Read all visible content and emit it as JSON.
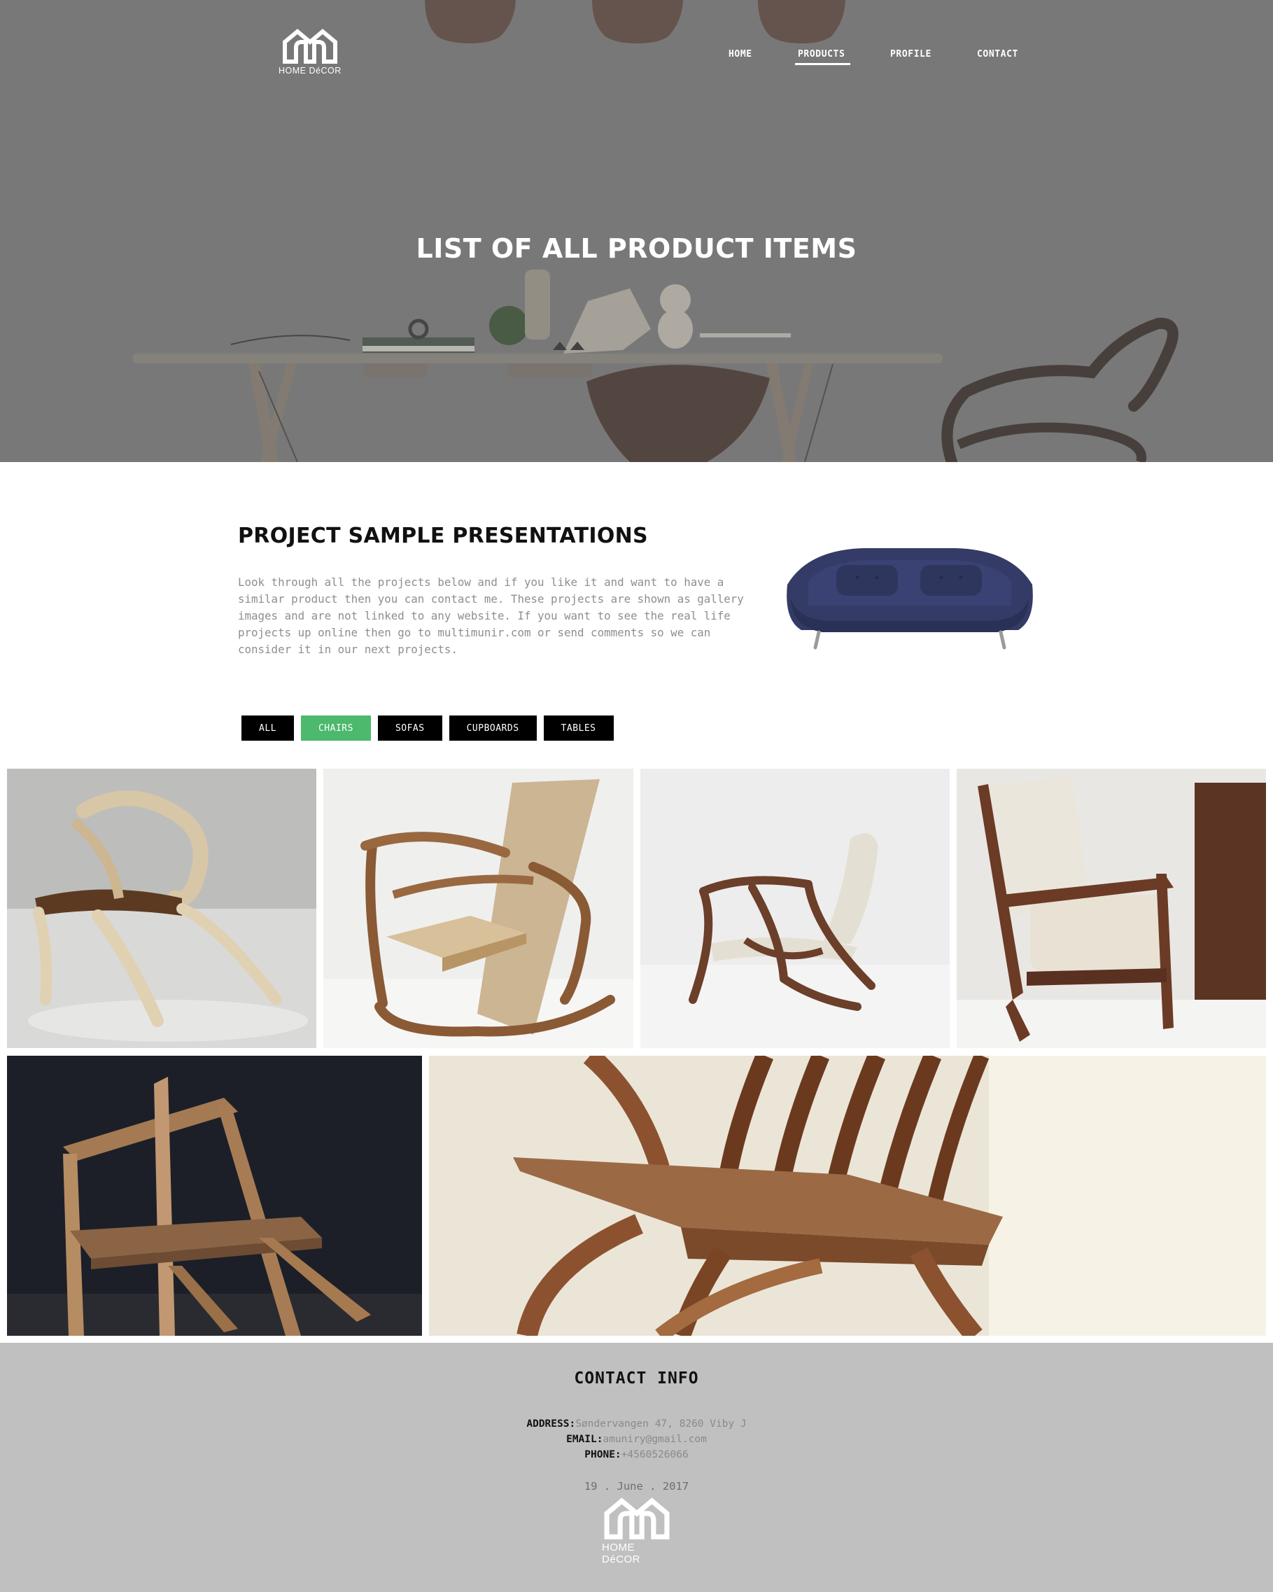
{
  "brand": {
    "logo_text": "HOME DéCOR"
  },
  "nav": {
    "items": [
      {
        "label": "HOME"
      },
      {
        "label": "PRODUCTS"
      },
      {
        "label": "PROFILE"
      },
      {
        "label": "CONTACT"
      }
    ],
    "active": "PRODUCTS"
  },
  "hero": {
    "title": "LIST OF ALL PRODUCT ITEMS"
  },
  "intro": {
    "title": "PROJECT SAMPLE PRESENTATIONS",
    "text": "Look through all the projects below and if you like it and want to have a similar product then you can contact me. These projects are shown as gallery images and are not linked to any website. If you want to see the real life projects up online then go to multimunir.com or send comments so we can consider it in our next projects."
  },
  "filters": {
    "items": [
      {
        "label": "ALL"
      },
      {
        "label": "CHAIRS"
      },
      {
        "label": "SOFAS"
      },
      {
        "label": "CUPBOARDS"
      },
      {
        "label": "TABLES"
      }
    ],
    "active": "CHAIRS"
  },
  "gallery": {
    "images": [
      {
        "icon": "sculptural-wood-chair-image"
      },
      {
        "icon": "rocking-chair-image"
      },
      {
        "icon": "lounge-chair-image"
      },
      {
        "icon": "upholstered-armchair-image"
      },
      {
        "icon": "angular-wood-chair-image"
      },
      {
        "icon": "curved-wood-chair-closeup-image"
      }
    ]
  },
  "footer": {
    "title": "CONTACT INFO",
    "address_label": "ADDRESS:",
    "address": "Søndervangen 47, 8260 Viby J",
    "email_label": "EMAIL:",
    "email": "amuniry@gmail.com",
    "phone_label": "PHONE:",
    "phone": "+4560526066",
    "date": "19 . June . 2017",
    "logo_text": "HOME DéCOR"
  },
  "colors": {
    "hero_overlay": "#747474",
    "accent_green": "#4cb96d",
    "footer_bg": "#c0c0c0",
    "button_black": "#000000"
  }
}
